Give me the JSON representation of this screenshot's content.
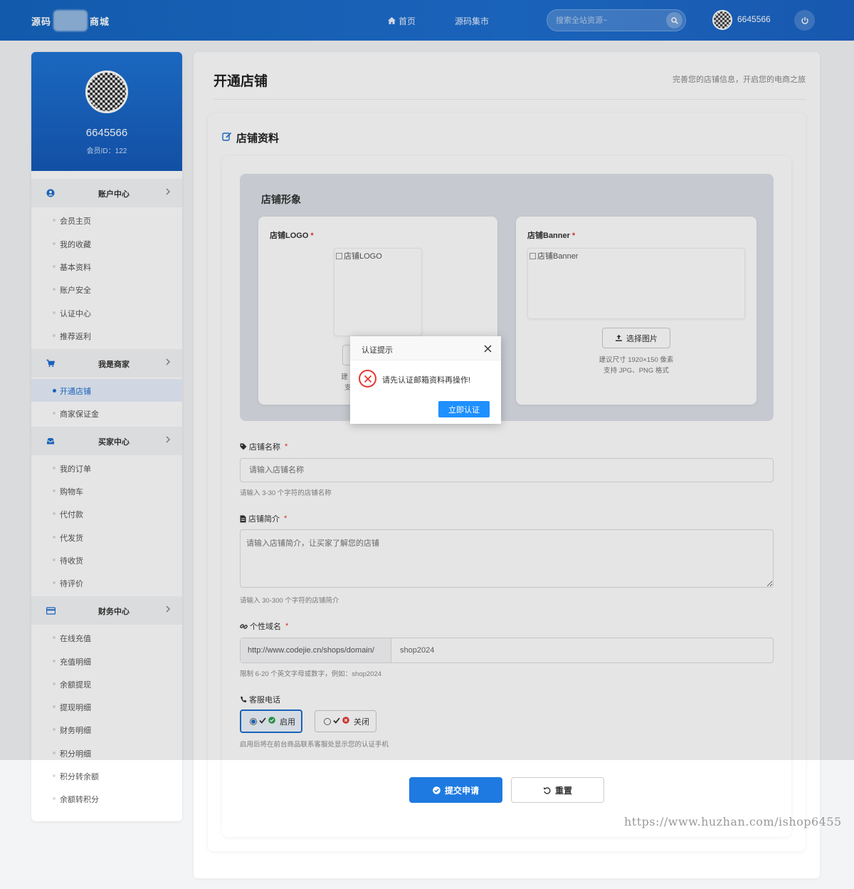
{
  "header": {
    "logo_left": "源码",
    "logo_right": "商城",
    "nav": [
      {
        "label": "首页",
        "icon": "home-icon"
      },
      {
        "label": "源码集市"
      }
    ],
    "search_placeholder": "搜索全站资源~",
    "username": "6645566"
  },
  "sidebar": {
    "profile": {
      "name": "6645566",
      "member_id": "会员ID：122"
    },
    "sections": [
      {
        "title": "账户中心",
        "icon": "user-circle-icon",
        "items": [
          "会员主页",
          "我的收藏",
          "基本资料",
          "账户安全",
          "认证中心",
          "推荐返利"
        ]
      },
      {
        "title": "我是商家",
        "icon": "cart-icon",
        "items": [
          "开通店铺",
          "商家保证金"
        ],
        "active": "开通店铺"
      },
      {
        "title": "买家中心",
        "icon": "inbox-icon",
        "items": [
          "我的订单",
          "购物车",
          "代付款",
          "代发货",
          "待收货",
          "待评价"
        ]
      },
      {
        "title": "财务中心",
        "icon": "credit-card-icon",
        "items": [
          "在线充值",
          "充值明细",
          "余额提现",
          "提现明细",
          "财务明细",
          "积分明细",
          "积分转余额",
          "余额转积分"
        ]
      }
    ]
  },
  "main": {
    "title": "开通店铺",
    "subtitle": "完善您的店铺信息，开启您的电商之旅",
    "card_title": "店铺资料",
    "image_panel": {
      "title": "店铺形象",
      "logo": {
        "label": "店铺LOGO",
        "alt": "店铺LOGO",
        "hint1": "建",
        "hint2": "支"
      },
      "banner": {
        "label": "店铺Banner",
        "alt": "店铺Banner",
        "button": "选择图片",
        "hint1": "建议尺寸 1920×150 像素",
        "hint2": "支持 JPG、PNG 格式"
      }
    },
    "fields": {
      "name": {
        "label": "店铺名称",
        "placeholder": "请输入店铺名称",
        "hint": "请输入 3-30 个字符的店铺名称"
      },
      "intro": {
        "label": "店铺简介",
        "placeholder": "请输入店铺简介，让买家了解您的店铺",
        "hint": "请输入 30-300 个字符的店铺简介"
      },
      "domain": {
        "label": "个性域名",
        "prefix": "http://www.codejie.cn/shops/domain/",
        "value": "shop2024",
        "hint": "限制 6-20 个英文字母或数字，例如：shop2024"
      },
      "phone": {
        "label": "客服电话",
        "on": "启用",
        "off": "关闭",
        "hint": "启用后将在前台商品联系客服处显示您的认证手机"
      }
    },
    "submit": "提交申请",
    "reset": "重置"
  },
  "modal": {
    "title": "认证提示",
    "message": "请先认证邮箱资料再操作!",
    "button": "立即认证"
  },
  "watermark": "https://www.huzhan.com/ishop6455",
  "colors": {
    "primary": "#1e6fd0",
    "button": "#1e90ff",
    "error": "#e53935"
  }
}
